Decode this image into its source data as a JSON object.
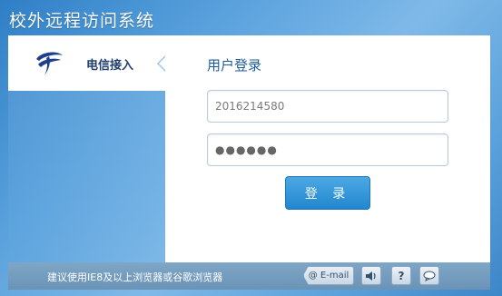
{
  "app": {
    "title": "校外远程访问系统"
  },
  "provider": {
    "label": "电信接入",
    "logo": "china-telecom-logo"
  },
  "login": {
    "title": "用户登录",
    "username_value": "2016214580",
    "password_mask": "●●●●●●",
    "submit_label": "登 录"
  },
  "footer": {
    "note": "建议使用IE8及以上浏览器或谷歌浏览器",
    "email_label": "@ E-mail",
    "help_label": "?"
  },
  "colors": {
    "accent": "#2287cf",
    "title_text": "#1f5b9a",
    "footer_bg": "#6a93b6"
  }
}
